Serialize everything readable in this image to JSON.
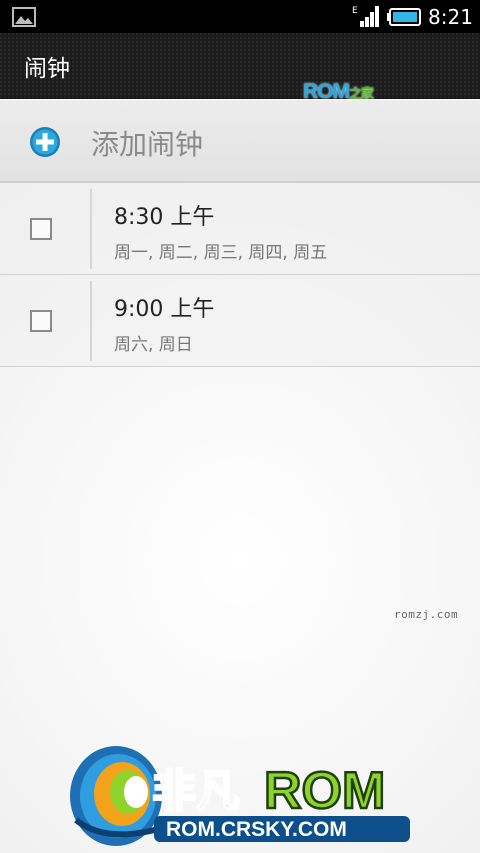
{
  "status_bar": {
    "time": "8:21",
    "network_type": "E",
    "icons": [
      "gallery-icon",
      "signal-icon",
      "battery-icon"
    ]
  },
  "action_bar": {
    "title": "闹钟"
  },
  "rom_logo": {
    "main": "ROM",
    "sub": "之家"
  },
  "add_alarm": {
    "label": "添加闹钟",
    "icon": "plus-circle-icon"
  },
  "alarms": [
    {
      "time": "8:30 上午",
      "days": "周一, 周二, 周三, 周四, 周五",
      "enabled": false
    },
    {
      "time": "9:00 上午",
      "days": "周六, 周日",
      "enabled": false
    }
  ],
  "watermark": {
    "small": "romzj.com",
    "brand_cn": "非凡",
    "brand_rom": "ROM",
    "brand_url": "ROM.CRSKY.COM"
  },
  "colors": {
    "accent_blue": "#2aa8e0",
    "logo_green": "#8ed22a",
    "action_bar_bg": "#1b1b1b"
  }
}
